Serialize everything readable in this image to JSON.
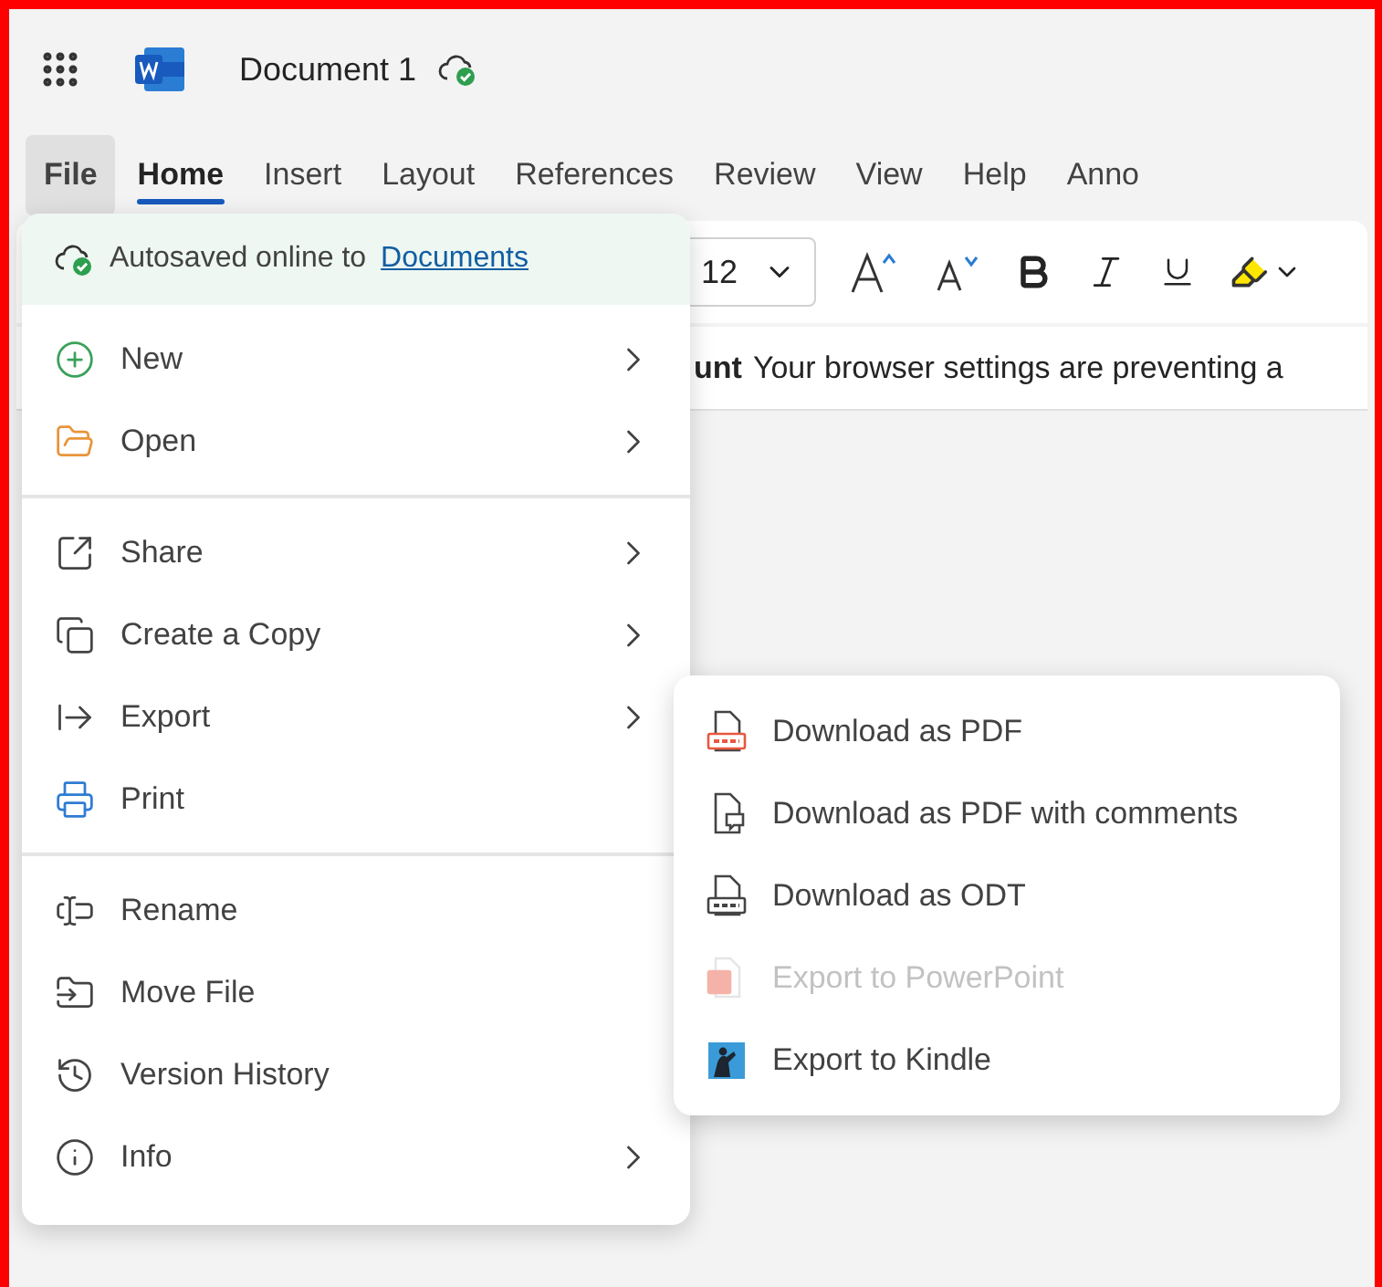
{
  "title_bar": {
    "document_title": "Document 1"
  },
  "tabs": [
    {
      "label": "File",
      "selected": false,
      "open": true
    },
    {
      "label": "Home",
      "selected": true,
      "open": false
    },
    {
      "label": "Insert",
      "selected": false,
      "open": false
    },
    {
      "label": "Layout",
      "selected": false,
      "open": false
    },
    {
      "label": "References",
      "selected": false,
      "open": false
    },
    {
      "label": "Review",
      "selected": false,
      "open": false
    },
    {
      "label": "View",
      "selected": false,
      "open": false
    },
    {
      "label": "Help",
      "selected": false,
      "open": false
    },
    {
      "label": "Anno",
      "selected": false,
      "open": false
    }
  ],
  "toolbar": {
    "font_size": "12"
  },
  "message_bar": {
    "title": "unt",
    "text": "Your browser settings are preventing a"
  },
  "file_menu": {
    "autosave_text": "Autosaved online to",
    "autosave_link": "Documents",
    "groups": [
      [
        {
          "label": "New",
          "has_submenu": true
        },
        {
          "label": "Open",
          "has_submenu": true
        }
      ],
      [
        {
          "label": "Share",
          "has_submenu": true
        },
        {
          "label": "Create a Copy",
          "has_submenu": true
        },
        {
          "label": "Export",
          "has_submenu": true
        },
        {
          "label": "Print",
          "has_submenu": false
        }
      ],
      [
        {
          "label": "Rename",
          "has_submenu": false
        },
        {
          "label": "Move File",
          "has_submenu": false
        },
        {
          "label": "Version History",
          "has_submenu": false
        },
        {
          "label": "Info",
          "has_submenu": true
        }
      ]
    ]
  },
  "export_submenu": [
    {
      "label": "Download as PDF",
      "disabled": false
    },
    {
      "label": "Download as PDF with comments",
      "disabled": false
    },
    {
      "label": "Download as ODT",
      "disabled": false
    },
    {
      "label": "Export to PowerPoint",
      "disabled": true
    },
    {
      "label": "Export to Kindle",
      "disabled": false
    }
  ]
}
